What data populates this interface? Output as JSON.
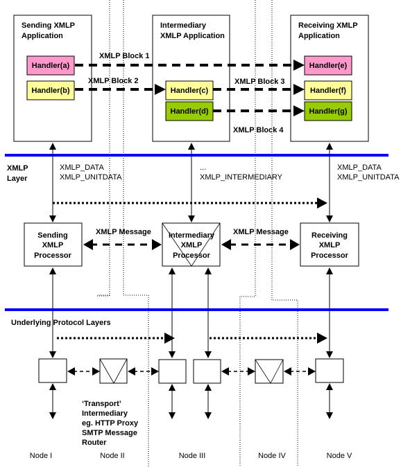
{
  "diagram": {
    "colors": {
      "layer_line": "#0000ff",
      "handler_pink": "#ff99cc",
      "handler_yellow": "#ffff99",
      "handler_green": "#99cc00"
    },
    "applications": {
      "sending": {
        "line1": "Sending XMLP",
        "line2": "Application"
      },
      "intermediary": {
        "line1": "Intermediary",
        "line2": "XMLP Application"
      },
      "receiving": {
        "line1": "Receiving XMLP",
        "line2": "Application"
      }
    },
    "handlers": {
      "a": "Handler(a)",
      "b": "Handler(b)",
      "c": "Handler(c)",
      "d": "Handler(d)",
      "e": "Handler(e)",
      "f": "Handler(f)",
      "g": "Handler(g)"
    },
    "blocks": {
      "b1": "XMLP Block 1",
      "b2": "XMLP Block 2",
      "b3": "XMLP Block 3",
      "b4": "XMLP Block 4"
    },
    "xmlp_layer": {
      "line1": "XMLP",
      "line2": "Layer"
    },
    "service_primitives": {
      "sending": {
        "line1": "XMLP_DATA",
        "line2": "XMLP_UNITDATA"
      },
      "intermediary": {
        "line1": "...",
        "line2": "XMLP_INTERMEDIARY"
      },
      "receiving": {
        "line1": "XMLP_DATA",
        "line2": "XMLP_UNITDATA"
      }
    },
    "processors": {
      "sending": {
        "line1": "Sending",
        "line2": "XMLP",
        "line3": "Processor"
      },
      "intermediary": {
        "line1": "Intermediary",
        "line2": "XMLP",
        "line3": "Processor"
      },
      "receiving": {
        "line1": "Receiving",
        "line2": "XMLP",
        "line3": "Processor"
      }
    },
    "message_labels": {
      "left": "XMLP Message",
      "right": "XMLP Message"
    },
    "underlying_layers": "Underlying Protocol Layers",
    "transport_note": {
      "line1": "‘Transport’",
      "line2": "Intermediary",
      "line3": "eg. HTTP Proxy",
      "line4": "SMTP Message",
      "line5": "Router"
    },
    "nodes": [
      "Node I",
      "Node II",
      "Node III",
      "Node IV",
      "Node V"
    ]
  }
}
